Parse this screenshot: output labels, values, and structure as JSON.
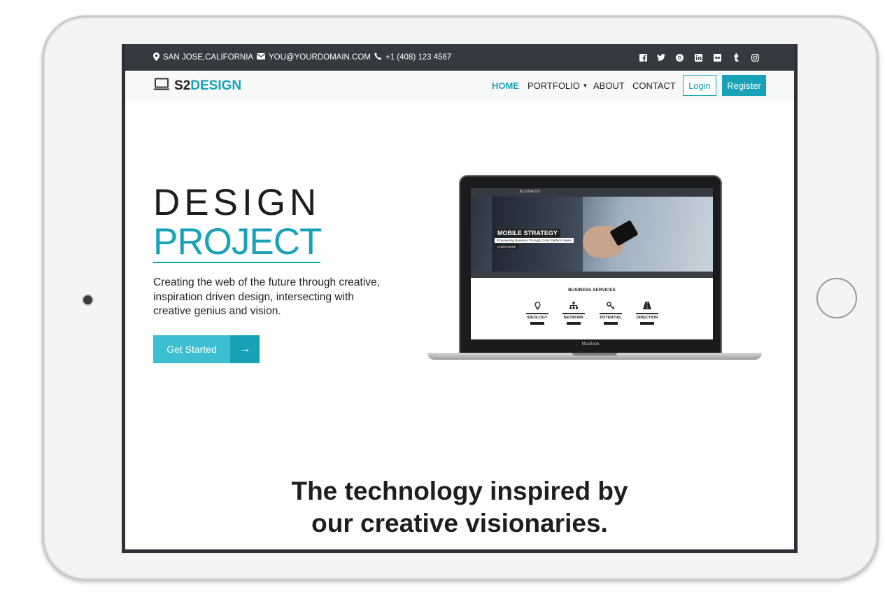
{
  "topbar": {
    "location": "SAN JOSE,CALIFORNIA",
    "email": "YOU@YOURDOMAIN.COM",
    "phone": "+1 (408) 123 4567",
    "social": [
      "facebook-icon",
      "twitter-icon",
      "google-plus-icon",
      "linkedin-icon",
      "flickr-icon",
      "tumblr-icon",
      "instagram-icon"
    ]
  },
  "logo": {
    "part1": "S2",
    "part2": "DESIGN"
  },
  "nav": {
    "home": "HOME",
    "portfolio": "PORTFOLIO",
    "about": "ABOUT",
    "contact": "CONTACT",
    "login": "Login",
    "register": "Register"
  },
  "hero": {
    "line1": "DESIGN",
    "line2": "PROJECT",
    "description": "Creating the web of the future through creative, inspiration driven design, intersecting with creative genius and vision.",
    "cta": "Get Started",
    "cta_arrow": "→"
  },
  "laptop_screen": {
    "brand": "BUSINESS",
    "headline": "MOBILE STRATEGY",
    "subline": "Empowering Business Through Cross Platform Views",
    "more": "LEARN MORE",
    "section_title": "BUSINESS SERVICES",
    "services": [
      "IDEOLOGY",
      "NETWORK",
      "POTENTIAL",
      "DIRECTION"
    ],
    "device_label": "MacBook"
  },
  "tagline": {
    "line1": "The technology inspired by",
    "line2": "our creative visionaries."
  },
  "colors": {
    "accent": "#17a2b8",
    "topbar": "#343a40",
    "text": "#1e1e1e"
  }
}
